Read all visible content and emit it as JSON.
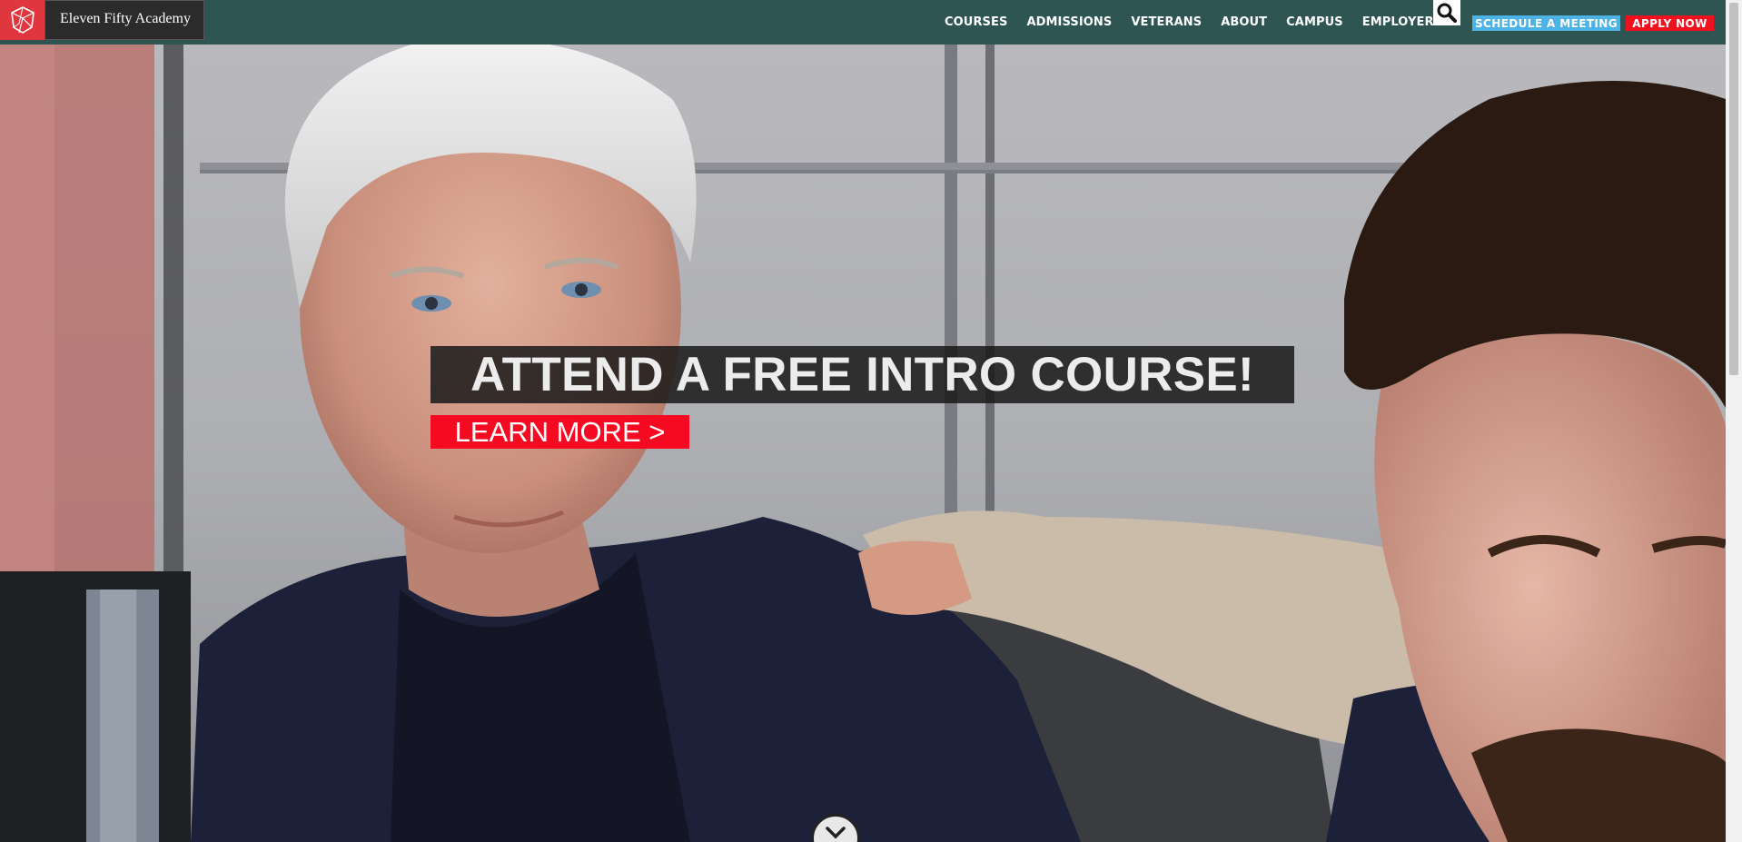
{
  "header": {
    "logo_text": "Eleven Fifty Academy",
    "logo_icon": "geometric-shield-icon",
    "nav": [
      {
        "label": "COURSES"
      },
      {
        "label": "ADMISSIONS"
      },
      {
        "label": "VETERANS"
      },
      {
        "label": "ABOUT"
      },
      {
        "label": "CAMPUS"
      },
      {
        "label": "EMPLOYERS"
      }
    ],
    "search_icon": "search-icon",
    "schedule_label": "SCHEDULE A MEETING",
    "apply_label": "APPLY NOW"
  },
  "hero": {
    "headline": "ATTEND A FREE INTRO COURSE!",
    "cta_label": "LEARN MORE >",
    "scroll_icon": "chevron-down-icon"
  },
  "colors": {
    "header_bg": "#2f5553",
    "brand_red": "#e0373f",
    "cta_red": "#f50a22",
    "schedule_blue": "#4db3e6"
  }
}
